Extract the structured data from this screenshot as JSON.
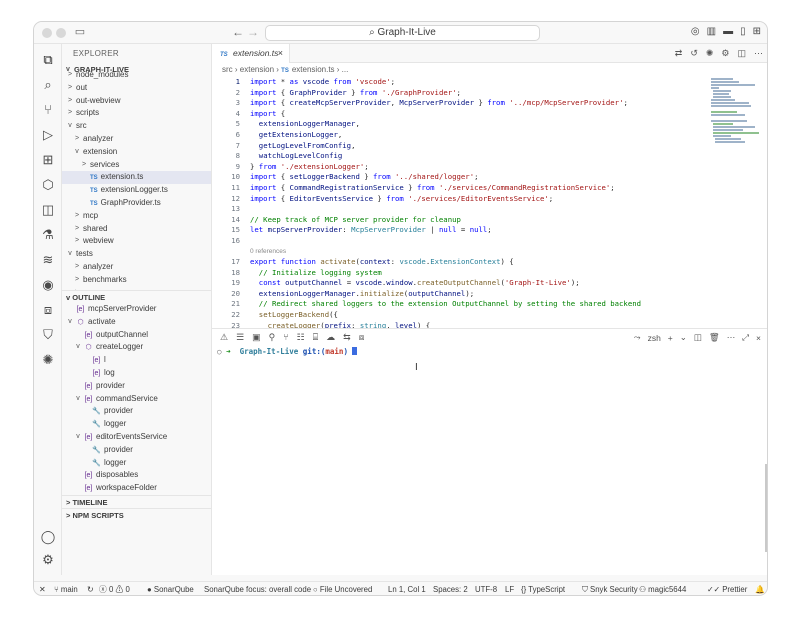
{
  "window": {
    "title": "Graph-It-Live"
  },
  "explorer": {
    "header": "EXPLORER",
    "project": "GRAPH-IT-LIVE",
    "items": [
      {
        "label": "node_modules",
        "level": 1,
        "twisty": ">"
      },
      {
        "label": "out",
        "level": 1,
        "twisty": ">"
      },
      {
        "label": "out-webview",
        "level": 1,
        "twisty": ">"
      },
      {
        "label": "scripts",
        "level": 1,
        "twisty": ">"
      },
      {
        "label": "src",
        "level": 1,
        "twisty": "v"
      },
      {
        "label": "analyzer",
        "level": 2,
        "twisty": ">"
      },
      {
        "label": "extension",
        "level": 2,
        "twisty": "v"
      },
      {
        "label": "services",
        "level": 3,
        "twisty": ">"
      },
      {
        "label": "extension.ts",
        "level": 3,
        "ts": true,
        "selected": true
      },
      {
        "label": "extensionLogger.ts",
        "level": 3,
        "ts": true
      },
      {
        "label": "GraphProvider.ts",
        "level": 3,
        "ts": true
      },
      {
        "label": "mcp",
        "level": 2,
        "twisty": ">"
      },
      {
        "label": "shared",
        "level": 2,
        "twisty": ">"
      },
      {
        "label": "webview",
        "level": 2,
        "twisty": ">"
      },
      {
        "label": "tests",
        "level": 1,
        "twisty": "v"
      },
      {
        "label": "analyzer",
        "level": 2,
        "twisty": ">"
      },
      {
        "label": "benchmarks",
        "level": 2,
        "twisty": ">"
      },
      {
        "label": "coverage",
        "level": 2,
        "twisty": ">"
      },
      {
        "label": "extension",
        "level": 2,
        "twisty": "v"
      },
      {
        "label": "BackgroundIndexingManager.test....",
        "level": 3,
        "ts": true
      },
      {
        "label": "CommandRegistrationService.test.ts",
        "level": 3,
        "ts": true
      },
      {
        "label": "EditorEventsService.test.ts",
        "level": 3,
        "ts": true
      },
      {
        "label": "EditorNavigationService.test.ts",
        "level": 3,
        "ts": true
      }
    ]
  },
  "outline": {
    "header": "OUTLINE",
    "items": [
      {
        "label": "mcpServerProvider",
        "level": 1,
        "icon": "variable-icon"
      },
      {
        "label": "activate",
        "level": 1,
        "icon": "function-icon",
        "twisty": "v"
      },
      {
        "label": "outputChannel",
        "level": 2,
        "icon": "variable-icon"
      },
      {
        "label": "createLogger",
        "level": 2,
        "icon": "function-icon",
        "twisty": "v"
      },
      {
        "label": "l",
        "level": 3,
        "icon": "variable-icon"
      },
      {
        "label": "log",
        "level": 3,
        "icon": "variable-icon"
      },
      {
        "label": "provider",
        "level": 2,
        "icon": "variable-icon"
      },
      {
        "label": "commandService",
        "level": 2,
        "icon": "variable-icon",
        "twisty": "v"
      },
      {
        "label": "provider",
        "level": 3,
        "icon": "property-icon"
      },
      {
        "label": "logger",
        "level": 3,
        "icon": "property-icon"
      },
      {
        "label": "editorEventsService",
        "level": 2,
        "icon": "variable-icon",
        "twisty": "v"
      },
      {
        "label": "provider",
        "level": 3,
        "icon": "property-icon"
      },
      {
        "label": "logger",
        "level": 3,
        "icon": "property-icon"
      },
      {
        "label": "disposables",
        "level": 2,
        "icon": "variable-icon"
      },
      {
        "label": "workspaceFolder",
        "level": 2,
        "icon": "variable-icon"
      }
    ]
  },
  "timeline": {
    "header": "TIMELINE"
  },
  "npm": {
    "header": "NPM SCRIPTS"
  },
  "editor": {
    "tab": {
      "badge": "TS",
      "label": "extension.ts"
    },
    "breadcrumb": {
      "a": "src",
      "b": "extension",
      "c": "extension.ts",
      "d": "..."
    },
    "codelens": "0 references"
  },
  "terminal": {
    "shell": "zsh",
    "prompt_dir": "Graph-It-Live",
    "prompt_git": "git:(",
    "prompt_branch": "main",
    "prompt_close": ")"
  },
  "status": {
    "branch": "main",
    "errors": "0",
    "warnings": "0",
    "sonarqube": "SonarQube",
    "sonar_focus": "SonarQube focus: overall code",
    "file_uncovered": "File Uncovered",
    "position": "Ln 1, Col 1",
    "spaces": "Spaces: 2",
    "encoding": "UTF-8",
    "eol": "LF",
    "language": "TypeScript",
    "snyk": "Snyk Security",
    "user": "magic5644",
    "prettier": "Prettier"
  }
}
